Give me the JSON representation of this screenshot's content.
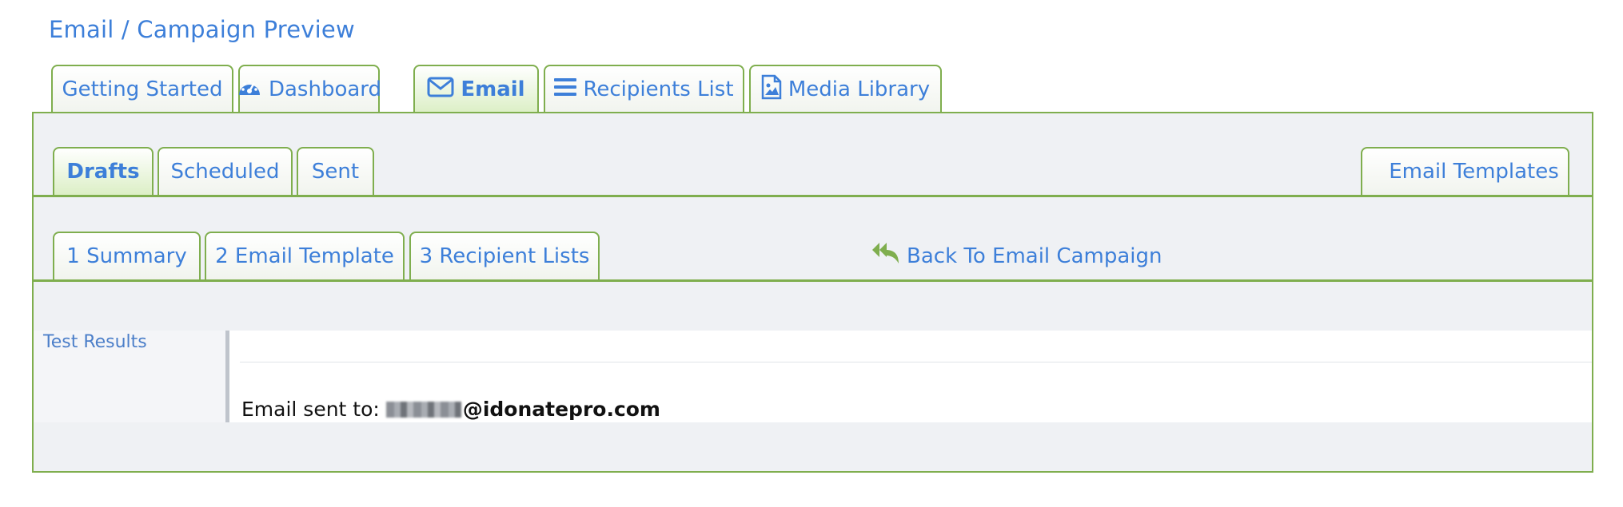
{
  "page": {
    "title": "Email / Campaign Preview"
  },
  "main_tabs": [
    {
      "label": "Getting Started",
      "icon": ""
    },
    {
      "label": "Dashboard",
      "icon": "dashboard-gauge-icon"
    },
    {
      "label": "Email",
      "icon": "envelope-icon",
      "active": true
    },
    {
      "label": "Recipients List",
      "icon": "list-icon"
    },
    {
      "label": "Media Library",
      "icon": "image-file-icon"
    }
  ],
  "sub_tabs": [
    {
      "label": "Drafts",
      "active": true
    },
    {
      "label": "Scheduled"
    },
    {
      "label": "Sent"
    }
  ],
  "templates_tab": {
    "label": "Email Templates"
  },
  "step_tabs": [
    {
      "label": "1 Summary"
    },
    {
      "label": "2 Email Template"
    },
    {
      "label": "3 Recipient Lists"
    }
  ],
  "back_link": {
    "label": "Back To Email Campaign",
    "icon": "reply-all-icon"
  },
  "test_results": {
    "label": "Test Results",
    "sent_prefix": "Email sent to:",
    "email_domain": "@idonatepro.com"
  },
  "colors": {
    "link_blue": "#3d7fd9",
    "border_green": "#7fae4e",
    "panel_gray": "#eff1f4",
    "active_tab_green": "#dcefc6"
  }
}
